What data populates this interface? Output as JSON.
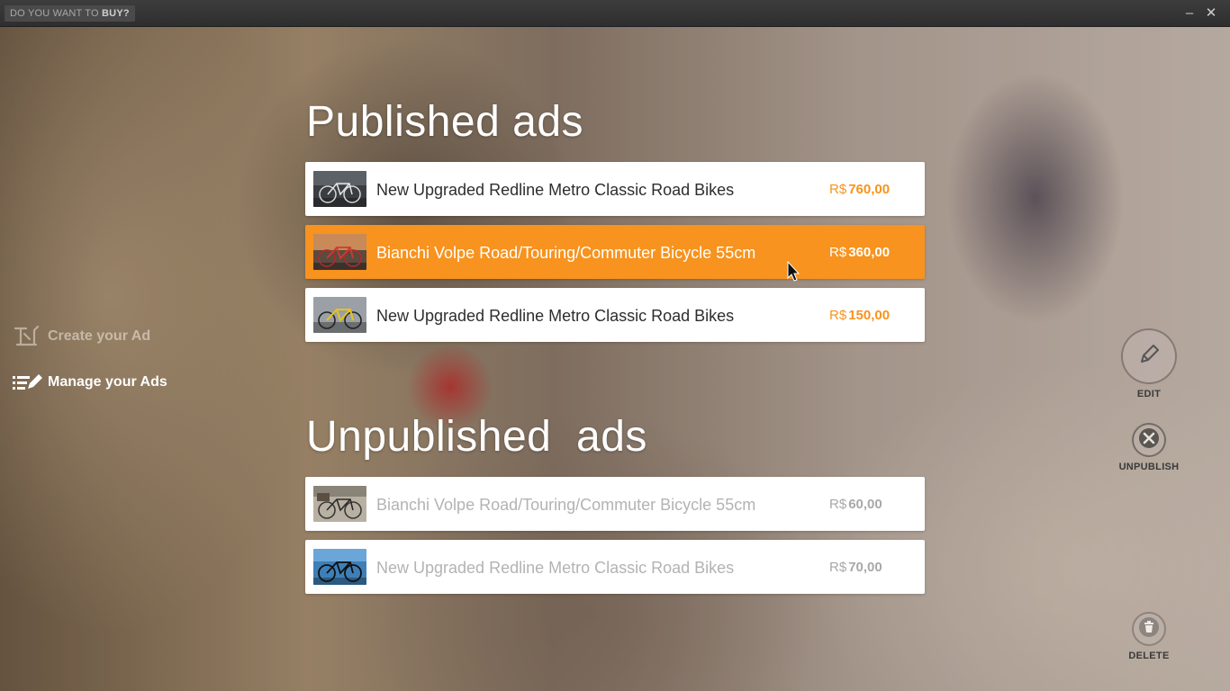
{
  "titlebar": {
    "prefix": "DO YOU WANT TO",
    "emphasis": "BUY?",
    "minimize": "–",
    "close": "✕"
  },
  "sidebar": {
    "items": [
      {
        "label": "Create your Ad",
        "icon": "create-ad-icon",
        "active": false
      },
      {
        "label": "Manage your Ads",
        "icon": "manage-list-icon",
        "active": true
      }
    ]
  },
  "published": {
    "heading": "Published ads",
    "ads": [
      {
        "title": "New Upgraded Redline Metro Classic Road Bikes",
        "currency": "R$",
        "price": "760,00",
        "selected": false
      },
      {
        "title": "Bianchi Volpe Road/Touring/Commuter Bicycle 55cm",
        "currency": "R$",
        "price": "360,00",
        "selected": true
      },
      {
        "title": "New Upgraded Redline Metro Classic Road Bikes",
        "currency": "R$",
        "price": "150,00",
        "selected": false
      }
    ]
  },
  "unpublished": {
    "heading": "Unpublished  ads",
    "ads": [
      {
        "title": "Bianchi Volpe Road/Touring/Commuter Bicycle 55cm",
        "currency": "R$",
        "price": "60,00"
      },
      {
        "title": "New Upgraded Redline Metro Classic Road Bikes",
        "currency": "R$",
        "price": "70,00"
      }
    ]
  },
  "actions": {
    "edit": "EDIT",
    "unpublish": "UNPUBLISH",
    "delete": "DELETE"
  },
  "colors": {
    "accent": "#f7931e",
    "titlebar": "#333333",
    "unpublished_text": "#b3b3b3"
  }
}
